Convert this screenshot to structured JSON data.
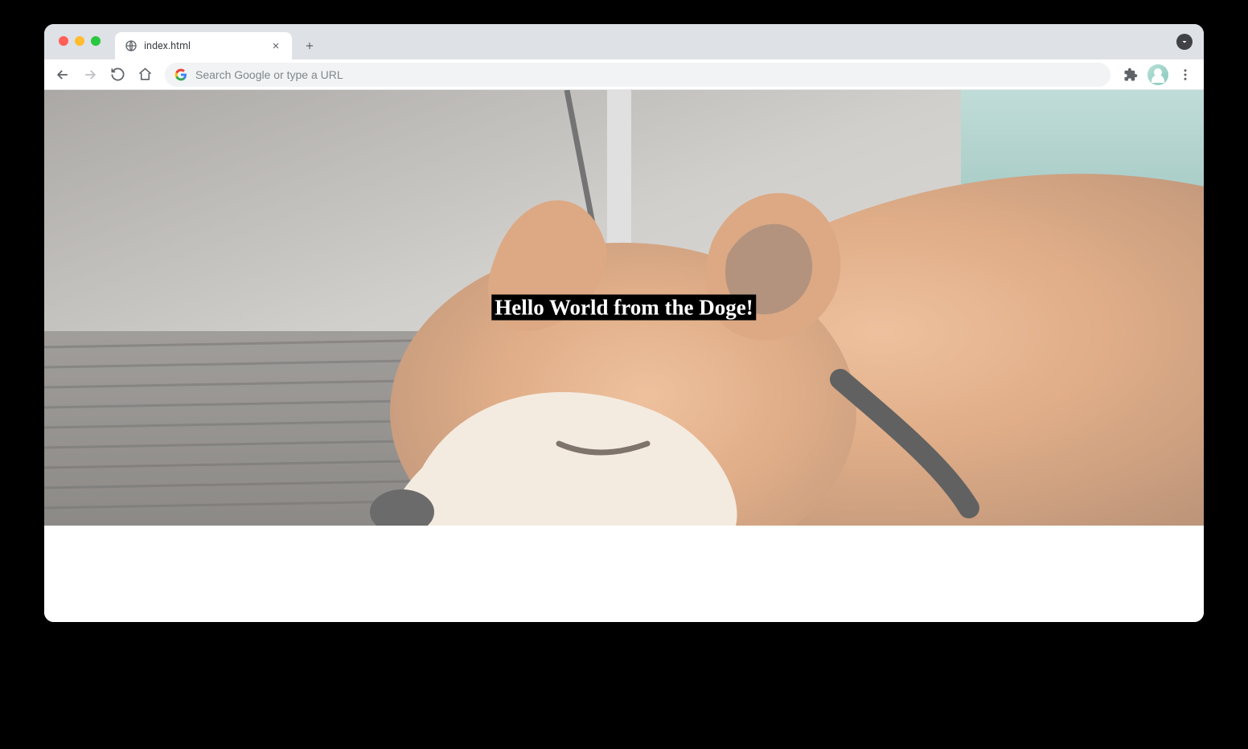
{
  "browser": {
    "tab": {
      "title": "index.html"
    },
    "omnibox": {
      "placeholder": "Search Google or type a URL"
    }
  },
  "page": {
    "hero": {
      "heading": "Hello World from the Doge!"
    }
  }
}
